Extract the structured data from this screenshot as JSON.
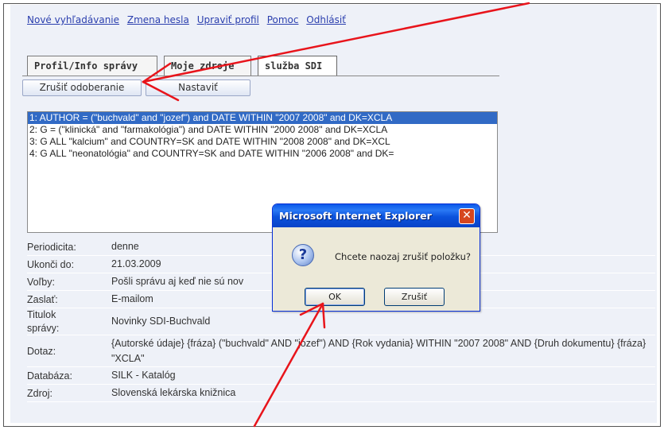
{
  "nav": {
    "links": [
      "Nové vyhľadávanie",
      "Zmena hesla",
      "Upraviť profil",
      "Pomoc",
      "Odhlásiť"
    ]
  },
  "tabs": [
    "Profil/Info správy",
    "Moje zdroje",
    "služba SDI"
  ],
  "actions": {
    "unsubscribe": "Zrušiť odoberanie",
    "configure": "Nastaviť"
  },
  "queries": [
    "1: AUTHOR = (\"buchvald\" and \"jozef\") and DATE WITHIN \"2007 2008\" and DK=XCLA",
    "2: G = (\"klinická\" and \"farmakológia\") and DATE WITHIN \"2000 2008\" and DK=XCLA",
    "3: G ALL \"kalcium\" and COUNTRY=SK and DATE WITHIN \"2008 2008\" and DK=XCL",
    "4: G ALL \"neonatológia\" and COUNTRY=SK and DATE WITHIN \"2006 2008\" and DK="
  ],
  "details": [
    {
      "label": "Periodicita:",
      "value": "denne"
    },
    {
      "label": "Ukonči do:",
      "value": "21.03.2009"
    },
    {
      "label": "Voľby:",
      "value": "Pošli správu aj keď nie sú nov"
    },
    {
      "label": "Zaslať:",
      "value": "E-mailom"
    },
    {
      "label": "Titulok správy:",
      "value": "Novinky SDI-Buchvald"
    },
    {
      "label": "Dotaz:",
      "value": "{Autorské údaje} {fráza} (\"buchvald\" AND \"jozef\") AND {Rok vydania} WITHIN \"2007 2008\" AND {Druh dokumentu} {fráza} \"XCLA\""
    },
    {
      "label": "Databáza:",
      "value": "SILK - Katalóg"
    },
    {
      "label": "Zdroj:",
      "value": "Slovenská lekárska knižnica"
    }
  ],
  "dialog": {
    "title": "Microsoft Internet Explorer",
    "message": "Chcete naozaj zrušiť položku?",
    "ok": "OK",
    "cancel": "Zrušiť",
    "close_glyph": "✕",
    "icon_glyph": "?"
  },
  "colors": {
    "annotation_arrow": "#e8141b",
    "selection": "#316ac5",
    "dialog_title": "#0a58e9"
  }
}
